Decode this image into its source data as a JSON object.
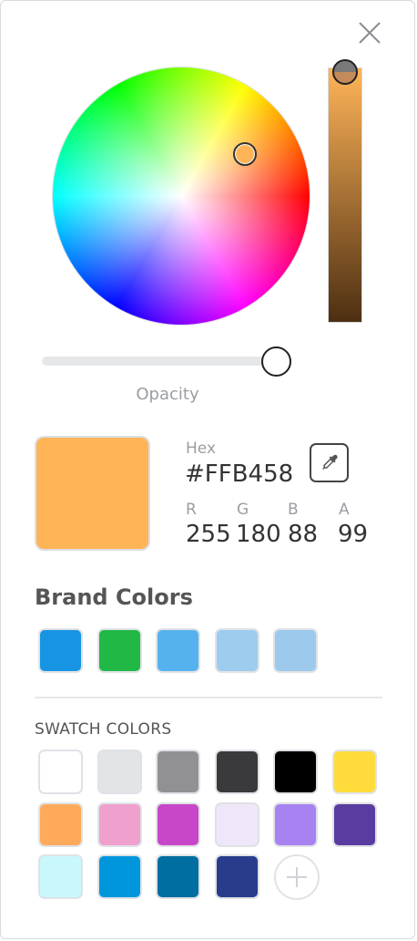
{
  "opacity": {
    "label": "Opacity",
    "value": 0.99
  },
  "current": {
    "color": "#FFB458",
    "hex_label": "Hex",
    "hex_value": "#FFB458",
    "channels": [
      {
        "label": "R",
        "value": "255"
      },
      {
        "label": "G",
        "value": "180"
      },
      {
        "label": "B",
        "value": "88"
      },
      {
        "label": "A",
        "value": "99"
      }
    ]
  },
  "brand": {
    "title": "Brand Colors",
    "colors": [
      "#1795e3",
      "#22b846",
      "#56b2ef",
      "#9dccee",
      "#9cc9ec"
    ]
  },
  "swatches": {
    "title": "SWATCH COLORS",
    "colors": [
      "#ffffff",
      "#e2e5e8",
      "#919194",
      "#3a3a3d",
      "#000000",
      "#ffdc3c",
      "#ffaa5a",
      "#f0a0cd",
      "#c846c8",
      "#f0e6fa",
      "#a882f0",
      "#5a3ca0",
      "#c8f8fc",
      "#0096dc",
      "#006ea0",
      "#283c8c"
    ]
  },
  "icons": {
    "close": "close-icon",
    "eyedropper": "eyedropper-icon",
    "add": "plus-icon"
  }
}
